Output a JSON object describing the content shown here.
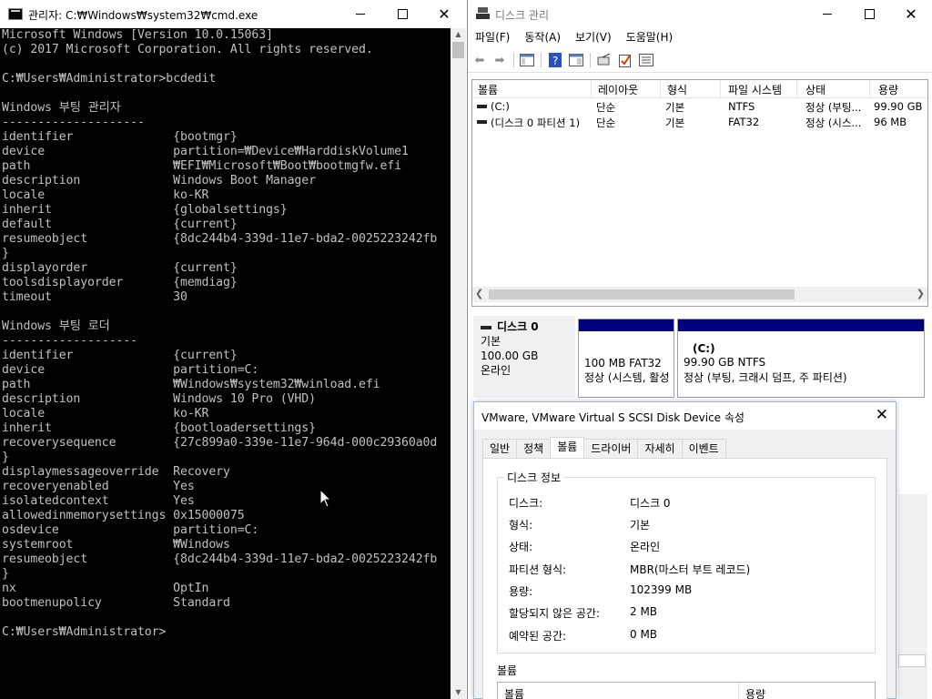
{
  "cmd": {
    "title": "관리자: C:₩Windows₩system32₩cmd.exe",
    "lines": [
      "Microsoft Windows [Version 10.0.15063]",
      "(c) 2017 Microsoft Corporation. All rights reserved.",
      "",
      "C:₩Users₩Administrator>bcdedit",
      "",
      "Windows 부팅 관리자",
      "--------------------",
      "identifier              {bootmgr}",
      "device                  partition=₩Device₩HarddiskVolume1",
      "path                    ₩EFI₩Microsoft₩Boot₩bootmgfw.efi",
      "description             Windows Boot Manager",
      "locale                  ko-KR",
      "inherit                 {globalsettings}",
      "default                 {current}",
      "resumeobject            {8dc244b4-339d-11e7-bda2-0025223242fb",
      "}",
      "displayorder            {current}",
      "toolsdisplayorder       {memdiag}",
      "timeout                 30",
      "",
      "Windows 부팅 로더",
      "-------------------",
      "identifier              {current}",
      "device                  partition=C:",
      "path                    ₩Windows₩system32₩winload.efi",
      "description             Windows 10 Pro (VHD)",
      "locale                  ko-KR",
      "inherit                 {bootloadersettings}",
      "recoverysequence        {27c899a0-339e-11e7-964d-000c29360a0d",
      "}",
      "displaymessageoverride  Recovery",
      "recoveryenabled         Yes",
      "isolatedcontext         Yes",
      "allowedinmemorysettings 0x15000075",
      "osdevice                partition=C:",
      "systemroot              ₩Windows",
      "resumeobject            {8dc244b4-339d-11e7-bda2-0025223242fb",
      "}",
      "nx                      OptIn",
      "bootmenupolicy          Standard",
      "",
      "C:₩Users₩Administrator>"
    ]
  },
  "disk_mgmt": {
    "title": "디스크 관리",
    "menu": [
      "파일(F)",
      "동작(A)",
      "보기(V)",
      "도움말(H)"
    ],
    "toolbar_icons": [
      "back-arrow-icon",
      "forward-arrow-icon",
      "console-tree-icon",
      "help-icon",
      "properties-icon",
      "rescan-icon",
      "check-icon",
      "list-icon"
    ],
    "columns": [
      "볼륨",
      "레이아웃",
      "형식",
      "파일 시스템",
      "상태",
      "용량"
    ],
    "volumes": [
      {
        "name": "(C:)",
        "layout": "단순",
        "type": "기본",
        "fs": "NTFS",
        "status": "정상 (부팅...",
        "capacity": "99.90 GB"
      },
      {
        "name": "(디스크 0 파티션 1)",
        "layout": "단순",
        "type": "기본",
        "fs": "FAT32",
        "status": "정상 (시스...",
        "capacity": "96 MB"
      }
    ],
    "disk": {
      "name": "디스크 0",
      "type": "기본",
      "size": "100.00 GB",
      "state": "온라인",
      "partitions": [
        {
          "title": "",
          "line1": "100 MB FAT32",
          "line2": "정상 (시스템, 활성"
        },
        {
          "title": "(C:)",
          "line1": "99.90 GB NTFS",
          "line2": "정상 (부팅, 크래시 덤프, 주 파티션)"
        }
      ]
    }
  },
  "dialog": {
    "title": "VMware, VMware Virtual S SCSI Disk Device 속성",
    "tabs": [
      "일반",
      "정책",
      "볼륨",
      "드라이버",
      "자세히",
      "이벤트"
    ],
    "active_tab": "볼륨",
    "group_title": "디스크 정보",
    "props": [
      {
        "k": "디스크:",
        "v": "디스크 0"
      },
      {
        "k": "형식:",
        "v": "기본"
      },
      {
        "k": "상태:",
        "v": "온라인"
      },
      {
        "k": "파티션 형식:",
        "v": "MBR(마스터 부트 레코드)"
      },
      {
        "k": "용량:",
        "v": "102399 MB"
      },
      {
        "k": "할당되지 않은 공간:",
        "v": "2 MB"
      },
      {
        "k": "예약된 공간:",
        "v": "0 MB"
      }
    ],
    "volumes_label": "볼륨",
    "vol_columns": [
      "볼륨",
      "용량"
    ]
  }
}
